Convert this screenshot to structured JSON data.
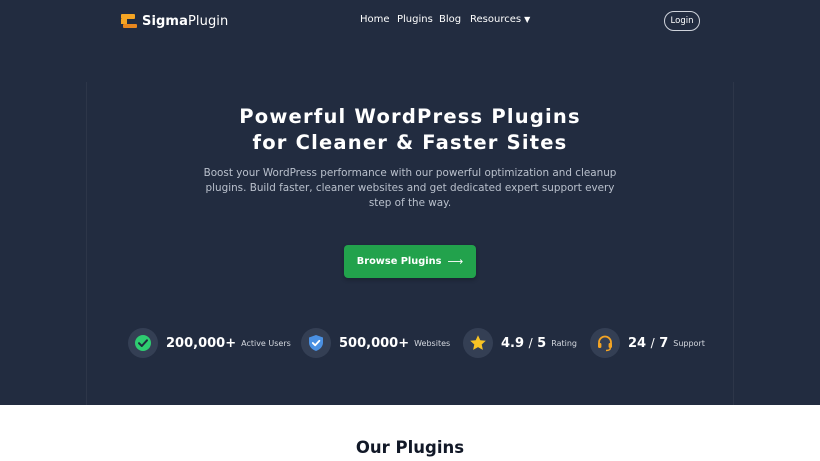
{
  "brand": {
    "name_bold": "Sigma",
    "name_regular": "Plugin"
  },
  "nav": {
    "items": [
      {
        "label": "Home"
      },
      {
        "label": "Plugins"
      },
      {
        "label": "Blog"
      },
      {
        "label": "Resources",
        "has_dropdown": true
      }
    ],
    "login_label": "Login"
  },
  "hero": {
    "title_line1": "Powerful WordPress Plugins",
    "title_line2": "for Cleaner & Faster Sites",
    "subtitle": "Boost your WordPress performance with our powerful optimization and cleanup plugins. Build faster, cleaner websites and get dedicated expert support every step of the way.",
    "cta_label": "Browse Plugins",
    "cta_icon": "arrow-right-icon"
  },
  "stats": [
    {
      "icon": "check-circle-icon",
      "value": "200,000+",
      "label": "Active Users"
    },
    {
      "icon": "shield-check-icon",
      "value": "500,000+",
      "label": "Websites"
    },
    {
      "icon": "star-icon",
      "value_main": "4.9",
      "value_sep": "/",
      "value_max": "5",
      "label": "Rating"
    },
    {
      "icon": "headset-icon",
      "value_main": "24",
      "value_sep": "/",
      "value_max": "7",
      "label": "Support"
    }
  ],
  "plugins_section": {
    "title": "Our Plugins"
  },
  "colors": {
    "hero_bg": "#222c40",
    "accent_green": "#22a24c",
    "logo_orange": "#f5a524",
    "check_green": "#2ecc71",
    "shield_blue": "#4a90e2",
    "star_yellow": "#f7c325",
    "headset_orange": "#f5a524"
  }
}
